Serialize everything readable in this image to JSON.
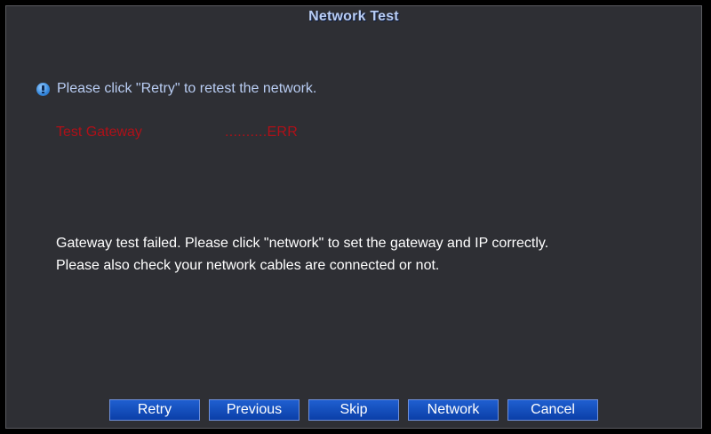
{
  "window": {
    "title": "Network Test"
  },
  "info": {
    "icon": "info-icon",
    "text": "Please click \"Retry\" to retest the network."
  },
  "test": {
    "label": "Test Gateway",
    "result": "..........ERR",
    "color": "#b01018"
  },
  "message": {
    "line1": "Gateway test failed. Please click \"network\" to set the gateway and IP correctly.",
    "line2": "Please also check your network cables are connected or not."
  },
  "buttons": {
    "retry": "Retry",
    "previous": "Previous",
    "skip": "Skip",
    "network": "Network",
    "cancel": "Cancel"
  },
  "colors": {
    "background": "#2e2f34",
    "title": "#b9cdf3",
    "button": "#0b3fa8"
  }
}
